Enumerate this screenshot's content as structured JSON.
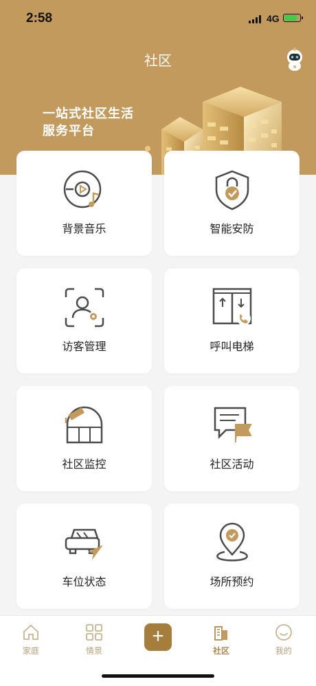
{
  "status_bar": {
    "time": "2:58",
    "network": "4G"
  },
  "header": {
    "title": "社区",
    "slogan_line1": "一站式社区生活",
    "slogan_line2": "服务平台"
  },
  "cards": [
    {
      "label": "背景音乐",
      "icon": "music-icon"
    },
    {
      "label": "智能安防",
      "icon": "shield-lock-icon"
    },
    {
      "label": "访客管理",
      "icon": "visitor-icon"
    },
    {
      "label": "呼叫电梯",
      "icon": "elevator-icon"
    },
    {
      "label": "社区监控",
      "icon": "monitor-icon"
    },
    {
      "label": "社区活动",
      "icon": "activity-icon"
    },
    {
      "label": "车位状态",
      "icon": "parking-icon"
    },
    {
      "label": "场所预约",
      "icon": "location-icon"
    }
  ],
  "tabbar": {
    "items": [
      {
        "label": "家庭",
        "icon": "home-icon"
      },
      {
        "label": "情景",
        "icon": "scene-grid-icon"
      },
      {
        "label": "+",
        "icon": "plus-icon"
      },
      {
        "label": "社区",
        "icon": "community-icon"
      },
      {
        "label": "我的",
        "icon": "profile-icon"
      }
    ],
    "active": "社区"
  },
  "colors": {
    "accent": "#c29a5e",
    "accent_dark": "#a57d3d",
    "background": "#f4f4f4"
  }
}
